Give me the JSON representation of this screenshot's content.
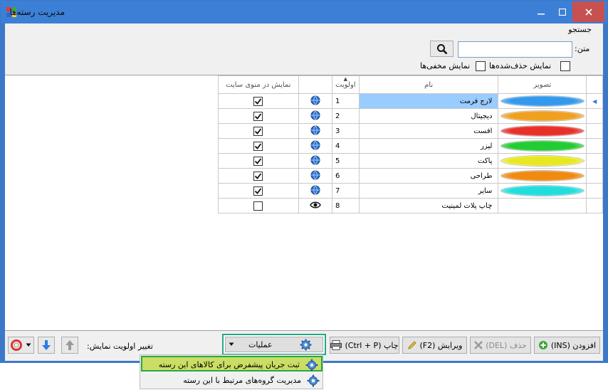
{
  "window": {
    "title": "مدیریت رسته‌ها"
  },
  "search": {
    "legend": "جستجو",
    "text_label": "متن:",
    "text_value": "",
    "show_deleted_label": "نمایش حذف‌شده‌ها",
    "show_hidden_label": "نمایش مخفی‌ها"
  },
  "grid": {
    "columns": {
      "image": "تصویر",
      "name": "نام",
      "priority": "اولویت",
      "site_menu": "نمایش در منوی سایت"
    },
    "rows": [
      {
        "name": "لارج فرمت",
        "priority": "1",
        "icon": "globe-icon",
        "checked": true,
        "badge": "#3399ee",
        "selected": true
      },
      {
        "name": "دیجیتال",
        "priority": "2",
        "icon": "globe-icon",
        "checked": true,
        "badge": "#f0a020"
      },
      {
        "name": "افست",
        "priority": "3",
        "icon": "globe-icon",
        "checked": true,
        "badge": "#e8302a"
      },
      {
        "name": "لیزر",
        "priority": "4",
        "icon": "globe-icon",
        "checked": true,
        "badge": "#22cc33"
      },
      {
        "name": "پاکت",
        "priority": "5",
        "icon": "globe-icon",
        "checked": true,
        "badge": "#e8e820"
      },
      {
        "name": "طراحی",
        "priority": "6",
        "icon": "globe-icon",
        "checked": true,
        "badge": "#f08a10"
      },
      {
        "name": "سایر",
        "priority": "7",
        "icon": "globe-icon",
        "checked": true,
        "badge": "#22dddd"
      },
      {
        "name": "چاپ پلات لمینیت",
        "priority": "8",
        "icon": "eye-icon",
        "checked": false,
        "badge": ""
      }
    ]
  },
  "toolbar": {
    "add_label": "(INS) افزودن",
    "delete_label": "(DEL) حذف",
    "edit_label": "(F2) ویرایش",
    "print_label": "(Ctrl + P) چاپ",
    "operations_label": "عملیات",
    "priority_label": "تغییر اولویت نمایش:"
  },
  "menu": {
    "items": [
      {
        "label": "ثبت جریان پیشفرض برای کالاهای این رسته"
      },
      {
        "label": "مدیریت گروه‌های مرتبط با این رسته"
      }
    ]
  },
  "colors": {
    "title_bar": "#3c7fd6",
    "selection": "#99ccff",
    "ops_border": "#22aa88",
    "menu_highlight": "#ccdd66"
  }
}
